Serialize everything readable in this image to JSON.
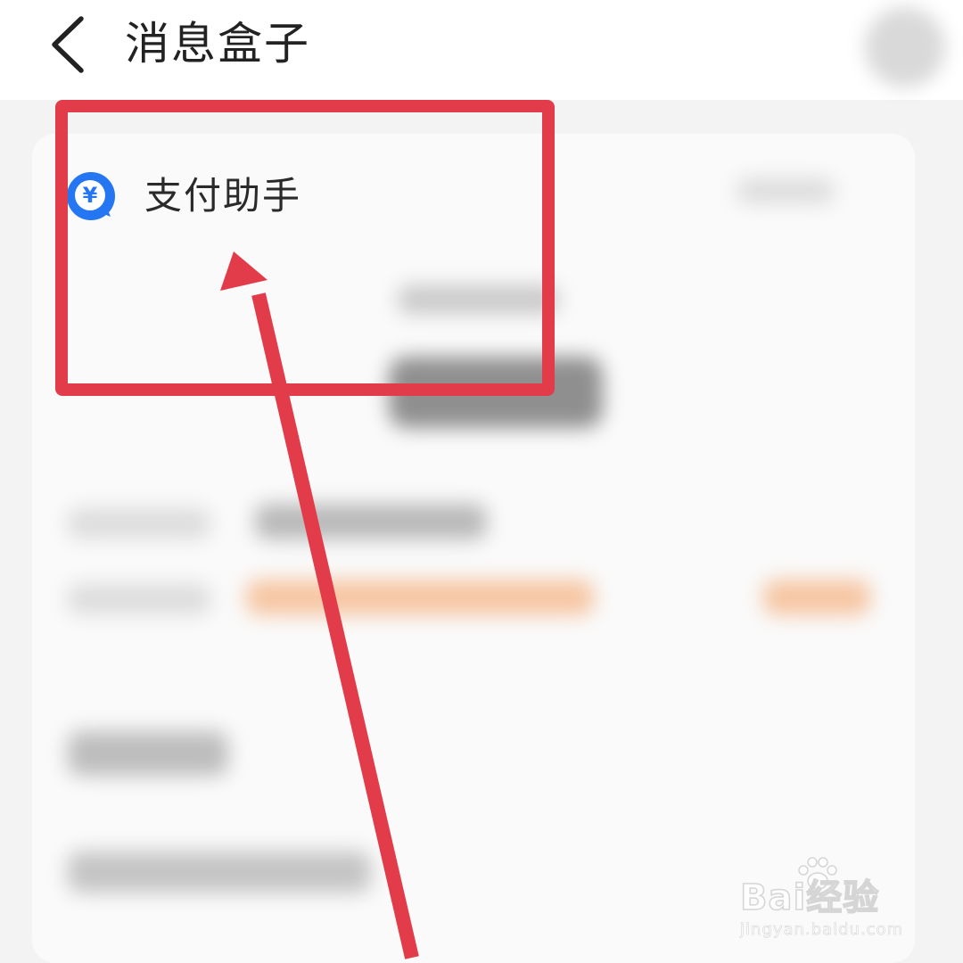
{
  "header": {
    "title": "消息盒子",
    "back_icon": "chevron-left-icon",
    "more_icon": "more-icon"
  },
  "message_card": {
    "icon": "yuan-chat-icon",
    "icon_glyph": "¥",
    "name": "支付助手"
  },
  "annotation": {
    "highlight_color": "#e23b4a",
    "arrow_color": "#e23b4a"
  },
  "watermark": {
    "brand": "Bai经验",
    "url": "jingyan.baidu.com"
  },
  "colors": {
    "accent_blue": "#2476f3",
    "page_bg": "#f3f3f3",
    "card_bg": "#fafafa"
  }
}
